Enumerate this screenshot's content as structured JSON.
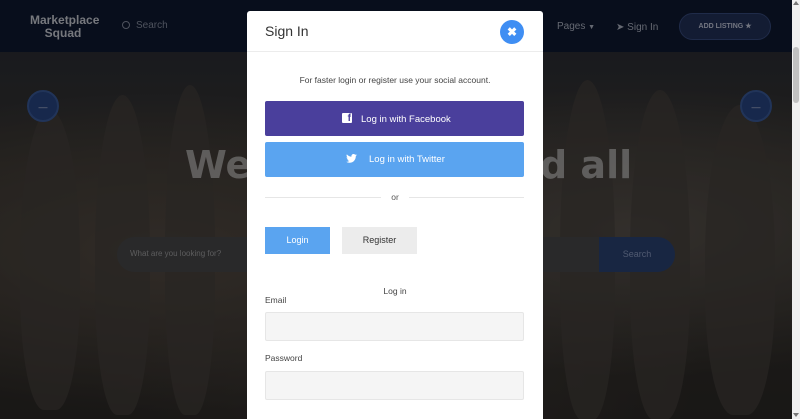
{
  "background_page": {
    "logo": "Marketplace Squad",
    "search_label": "Search",
    "nav_pages": "Pages",
    "nav_signin": "Sign In",
    "add_listing": "ADD LISTING",
    "hero_text_left": "We",
    "hero_text_right": "d all",
    "search_placeholder": "What are you looking for?",
    "search_button": "Search"
  },
  "modal": {
    "title": "Sign In",
    "close_icon": "close-icon",
    "social_text": "For faster login or register use your social account.",
    "facebook_button": "Log in with Facebook",
    "twitter_button": "Log in with Twitter",
    "or_text": "or",
    "tabs": [
      {
        "label": "Login",
        "active": true
      },
      {
        "label": "Register",
        "active": false
      }
    ],
    "form_heading": "Log in",
    "email_label": "Email",
    "email_value": "",
    "password_label": "Password",
    "password_value": ""
  },
  "colors": {
    "accent_blue": "#3f8ef3",
    "facebook": "#4a3f9c",
    "twitter": "#5aa4f0",
    "header_bg": "#0f1a33"
  }
}
